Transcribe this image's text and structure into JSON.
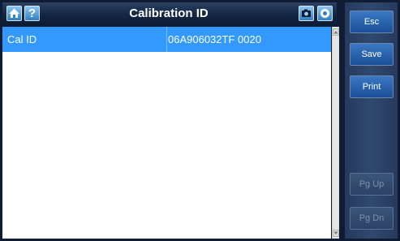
{
  "header": {
    "title": "Calibration ID",
    "help_label": "?",
    "icons": [
      "home-icon",
      "help-icon",
      "camera-icon",
      "record-icon"
    ]
  },
  "table": {
    "rows": [
      {
        "label": "Cal ID",
        "value": "06A906032TF 0020"
      }
    ]
  },
  "sidebar": {
    "esc": "Esc",
    "save": "Save",
    "print": "Print",
    "pg_up": "Pg Up",
    "pg_dn": "Pg Dn"
  },
  "colors": {
    "selected_row": "#3399ff",
    "header_bg": "#132643",
    "button_active": "#2a64ad",
    "button_disabled": "#34496e"
  }
}
